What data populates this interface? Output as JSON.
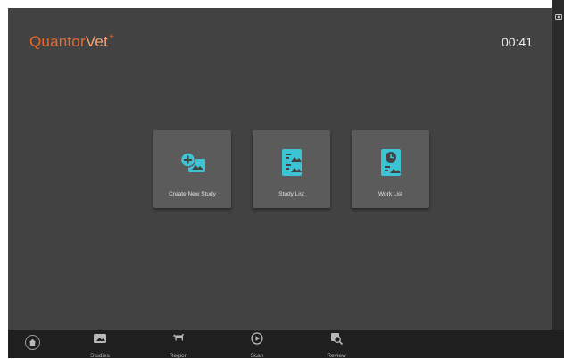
{
  "app": {
    "logo_part1": "Quantor",
    "logo_part2": "Vet",
    "logo_mark": "+"
  },
  "header": {
    "clock": "00:41"
  },
  "tiles": [
    {
      "label": "Create New Study",
      "icon": "create-study-icon"
    },
    {
      "label": "Study List",
      "icon": "study-list-icon"
    },
    {
      "label": "Work List",
      "icon": "work-list-icon"
    }
  ],
  "nav": {
    "home_icon": "home-icon",
    "items": [
      {
        "label": "Studies",
        "icon": "studies-icon"
      },
      {
        "label": "Region",
        "icon": "region-icon"
      },
      {
        "label": "Scan",
        "icon": "scan-icon"
      },
      {
        "label": "Review",
        "icon": "review-icon"
      }
    ]
  },
  "colors": {
    "accent": "#e8692a",
    "icon": "#3cc4d6",
    "background": "#424242",
    "tile": "#5b5b5b",
    "navbar": "#1f1f1f"
  }
}
